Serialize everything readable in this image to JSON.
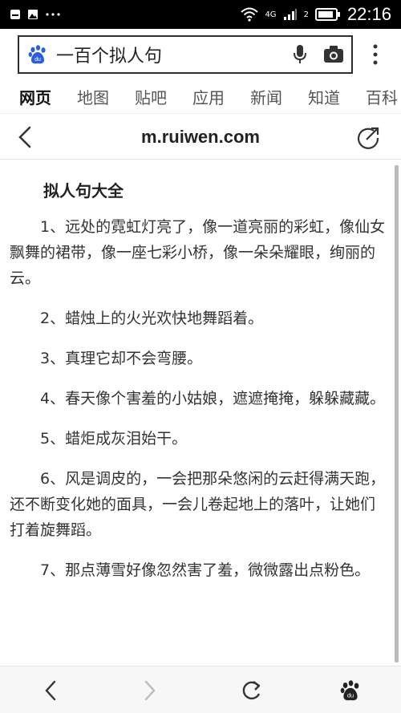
{
  "status_bar": {
    "network_label": "4G",
    "sim_label": "2",
    "time": "22:16",
    "icons": [
      "notification-icon",
      "image-icon",
      "more-dots-icon",
      "wifi-icon",
      "signal-icon",
      "battery-icon"
    ]
  },
  "search": {
    "query": "一百个拟人句",
    "logo_text": "du",
    "icons": [
      "baidu-paw-icon",
      "mic-icon",
      "camera-icon",
      "more-vertical-icon"
    ]
  },
  "tabs": [
    {
      "label": "网页",
      "active": true
    },
    {
      "label": "地图",
      "active": false
    },
    {
      "label": "贴吧",
      "active": false
    },
    {
      "label": "应用",
      "active": false
    },
    {
      "label": "新闻",
      "active": false
    },
    {
      "label": "知道",
      "active": false
    },
    {
      "label": "百科",
      "active": false
    }
  ],
  "page_header": {
    "url": "m.ruiwen.com",
    "icons": [
      "back-chevron-icon",
      "share-icon"
    ]
  },
  "article": {
    "title": "拟人句大全",
    "paragraphs": [
      "1、远处的霓虹灯亮了，像一道亮丽的彩虹，像仙女飘舞的裙带，像一座七彩小桥，像一朵朵耀眼，绚丽的云。",
      "2、蜡烛上的火光欢快地舞蹈着。",
      "3、真理它却不会弯腰。",
      "4、春天像个害羞的小姑娘，遮遮掩掩，躲躲藏藏。",
      "5、蜡炬成灰泪始干。",
      "6、风是调皮的，一会把那朵悠闲的云赶得满天跑，还不断变化她的面具，一会儿卷起地上的落叶，让她们打着旋舞蹈。",
      "7、那点薄雪好像忽然害了羞，微微露出点粉色。"
    ]
  },
  "bottom_nav": {
    "icons": [
      "back-arrow-icon",
      "forward-arrow-icon",
      "refresh-icon",
      "baidu-paw-icon"
    ],
    "logo_text": "du"
  },
  "colors": {
    "status_bar_bg": "#000000",
    "baidu_blue": "#2b5fd9",
    "text": "#333333",
    "disabled": "#bbbbbb"
  }
}
